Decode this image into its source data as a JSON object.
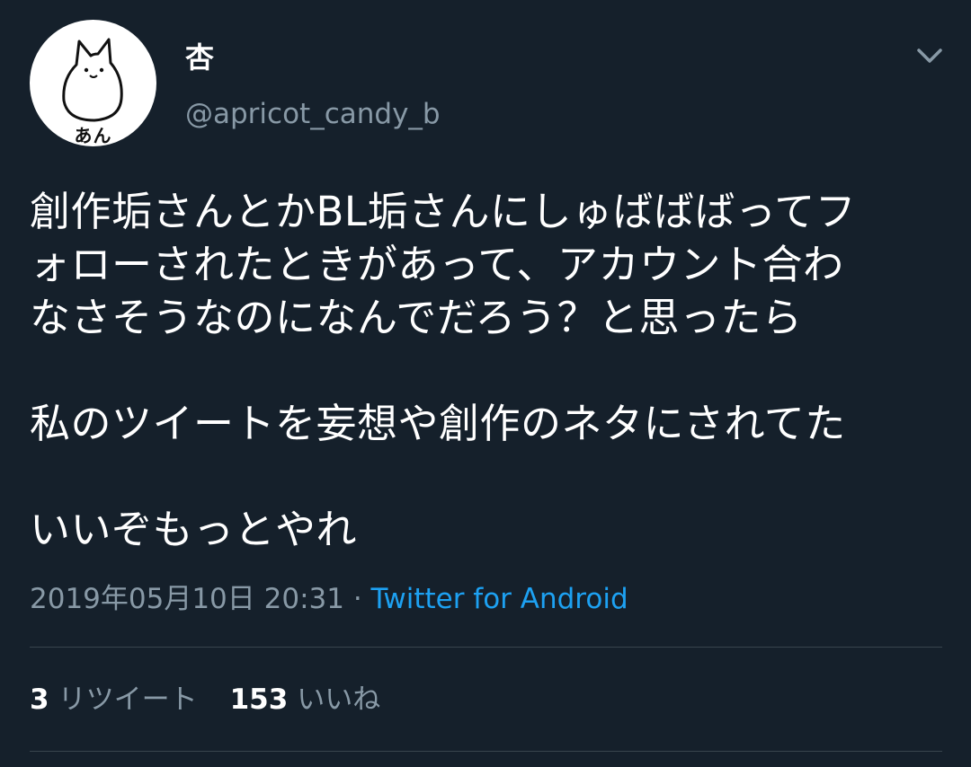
{
  "author": {
    "display_name": "杏",
    "handle": "@apricot_candy_b",
    "avatar_caption": "あん"
  },
  "tweet": {
    "lines": [
      "創作垢さんとかBL垢さんにしゅばばばってフ",
      "ォローされたときがあって、アカウント合わ",
      "なさそうなのになんでだろう？と思ったら",
      "",
      "私のツイートを妄想や創作のネタにされてた",
      "",
      "いいぞもっとやれ"
    ]
  },
  "meta": {
    "timestamp": "2019年05月10日 20:31",
    "separator": " · ",
    "source": "Twitter for Android"
  },
  "stats": {
    "retweet_count": "3",
    "retweet_label": "リツイート",
    "like_count": "153",
    "like_label": "いいね"
  },
  "icons": {
    "menu": "chevron-down-icon"
  },
  "colors": {
    "background": "#15202b",
    "text_primary": "#ffffff",
    "text_secondary": "#8899a6",
    "link": "#1da1f2",
    "divider": "#38444d"
  }
}
